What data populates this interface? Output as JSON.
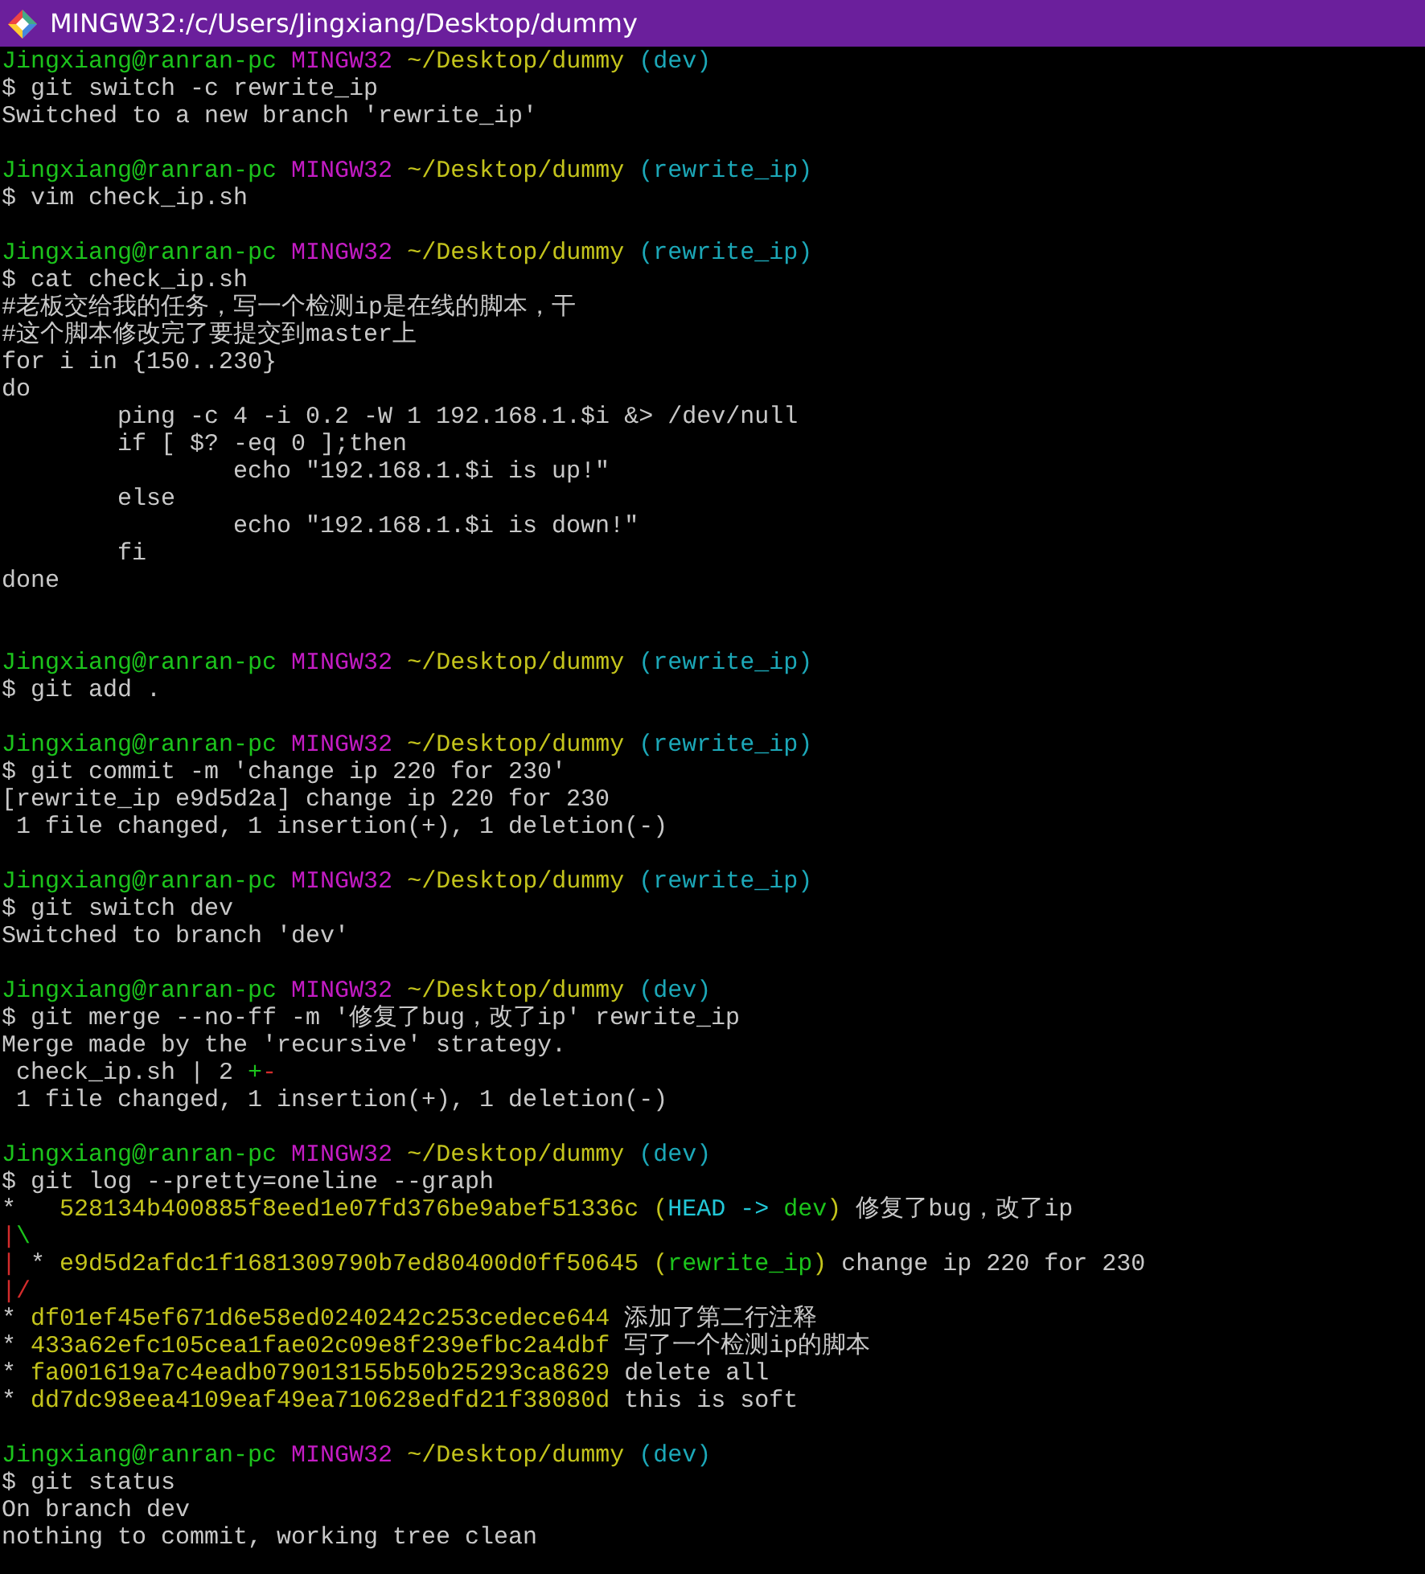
{
  "window": {
    "title": "MINGW32:/c/Users/Jingxiang/Desktop/dummy"
  },
  "lines": [
    {
      "kind": "prompt",
      "user": "Jingxiang@ranran-pc",
      "system": "MINGW32",
      "path": "~/Desktop/dummy",
      "branch": "(dev)"
    },
    {
      "kind": "text",
      "segments": [
        {
          "text": "$ git switch -c rewrite_ip"
        }
      ]
    },
    {
      "kind": "text",
      "segments": [
        {
          "text": "Switched to a new branch 'rewrite_ip'"
        }
      ]
    },
    {
      "kind": "blank"
    },
    {
      "kind": "prompt",
      "user": "Jingxiang@ranran-pc",
      "system": "MINGW32",
      "path": "~/Desktop/dummy",
      "branch": "(rewrite_ip)"
    },
    {
      "kind": "text",
      "segments": [
        {
          "text": "$ vim check_ip.sh"
        }
      ]
    },
    {
      "kind": "blank"
    },
    {
      "kind": "prompt",
      "user": "Jingxiang@ranran-pc",
      "system": "MINGW32",
      "path": "~/Desktop/dummy",
      "branch": "(rewrite_ip)"
    },
    {
      "kind": "text",
      "segments": [
        {
          "text": "$ cat check_ip.sh"
        }
      ]
    },
    {
      "kind": "text",
      "segments": [
        {
          "text": "#老板交给我的任务，写一个检测ip是在线的脚本，干"
        }
      ]
    },
    {
      "kind": "text",
      "segments": [
        {
          "text": "#这个脚本修改完了要提交到master上"
        }
      ]
    },
    {
      "kind": "text",
      "segments": [
        {
          "text": "for i in {150..230}"
        }
      ]
    },
    {
      "kind": "text",
      "segments": [
        {
          "text": "do"
        }
      ]
    },
    {
      "kind": "text",
      "segments": [
        {
          "text": "        ping -c 4 -i 0.2 -W 1 192.168.1.$i &> /dev/null"
        }
      ]
    },
    {
      "kind": "text",
      "segments": [
        {
          "text": "        if [ $? -eq 0 ];then"
        }
      ]
    },
    {
      "kind": "text",
      "segments": [
        {
          "text": "                echo \"192.168.1.$i is up!\""
        }
      ]
    },
    {
      "kind": "text",
      "segments": [
        {
          "text": "        else"
        }
      ]
    },
    {
      "kind": "text",
      "segments": [
        {
          "text": "                echo \"192.168.1.$i is down!\""
        }
      ]
    },
    {
      "kind": "text",
      "segments": [
        {
          "text": "        fi"
        }
      ]
    },
    {
      "kind": "text",
      "segments": [
        {
          "text": "done"
        }
      ]
    },
    {
      "kind": "blank"
    },
    {
      "kind": "blank"
    },
    {
      "kind": "prompt",
      "user": "Jingxiang@ranran-pc",
      "system": "MINGW32",
      "path": "~/Desktop/dummy",
      "branch": "(rewrite_ip)"
    },
    {
      "kind": "text",
      "segments": [
        {
          "text": "$ git add ."
        }
      ]
    },
    {
      "kind": "blank"
    },
    {
      "kind": "prompt",
      "user": "Jingxiang@ranran-pc",
      "system": "MINGW32",
      "path": "~/Desktop/dummy",
      "branch": "(rewrite_ip)"
    },
    {
      "kind": "text",
      "segments": [
        {
          "text": "$ git commit -m 'change ip 220 for 230'"
        }
      ]
    },
    {
      "kind": "text",
      "segments": [
        {
          "text": "[rewrite_ip e9d5d2a] change ip 220 for 230"
        }
      ]
    },
    {
      "kind": "text",
      "segments": [
        {
          "text": " 1 file changed, 1 insertion(+), 1 deletion(-)"
        }
      ]
    },
    {
      "kind": "blank"
    },
    {
      "kind": "prompt",
      "user": "Jingxiang@ranran-pc",
      "system": "MINGW32",
      "path": "~/Desktop/dummy",
      "branch": "(rewrite_ip)"
    },
    {
      "kind": "text",
      "segments": [
        {
          "text": "$ git switch dev"
        }
      ]
    },
    {
      "kind": "text",
      "segments": [
        {
          "text": "Switched to branch 'dev'"
        }
      ]
    },
    {
      "kind": "blank"
    },
    {
      "kind": "prompt",
      "user": "Jingxiang@ranran-pc",
      "system": "MINGW32",
      "path": "~/Desktop/dummy",
      "branch": "(dev)"
    },
    {
      "kind": "text",
      "segments": [
        {
          "text": "$ git merge --no-ff -m '修复了bug，改了ip' rewrite_ip"
        }
      ]
    },
    {
      "kind": "text",
      "segments": [
        {
          "text": "Merge made by the 'recursive' strategy."
        }
      ]
    },
    {
      "kind": "text",
      "segments": [
        {
          "text": " check_ip.sh | 2 "
        },
        {
          "text": "+",
          "color": "#1cc41c"
        },
        {
          "text": "-",
          "color": "#d42c2c"
        }
      ]
    },
    {
      "kind": "text",
      "segments": [
        {
          "text": " 1 file changed, 1 insertion(+), 1 deletion(-)"
        }
      ]
    },
    {
      "kind": "blank"
    },
    {
      "kind": "prompt",
      "user": "Jingxiang@ranran-pc",
      "system": "MINGW32",
      "path": "~/Desktop/dummy",
      "branch": "(dev)"
    },
    {
      "kind": "text",
      "segments": [
        {
          "text": "$ git log --pretty=oneline --graph"
        }
      ]
    },
    {
      "kind": "text",
      "segments": [
        {
          "text": "*   "
        },
        {
          "text": "528134b400885f8eed1e07fd376be9abef51336c (",
          "color": "#c4c41c"
        },
        {
          "text": "HEAD -> ",
          "color": "#22c8d8"
        },
        {
          "text": "dev",
          "color": "#1cc41c"
        },
        {
          "text": ")",
          "color": "#c4c41c"
        },
        {
          "text": " 修复了bug，改了ip"
        }
      ]
    },
    {
      "kind": "text",
      "segments": [
        {
          "text": "|",
          "color": "#d42c2c"
        },
        {
          "text": "\\",
          "color": "#1cc41c"
        }
      ]
    },
    {
      "kind": "text",
      "segments": [
        {
          "text": "|",
          "color": "#d42c2c"
        },
        {
          "text": " * "
        },
        {
          "text": "e9d5d2afdc1f1681309790b7ed80400d0ff50645 (",
          "color": "#c4c41c"
        },
        {
          "text": "rewrite_ip",
          "color": "#1cc41c"
        },
        {
          "text": ")",
          "color": "#c4c41c"
        },
        {
          "text": " change ip 220 for 230"
        }
      ]
    },
    {
      "kind": "text",
      "segments": [
        {
          "text": "|/",
          "color": "#d42c2c"
        }
      ]
    },
    {
      "kind": "text",
      "segments": [
        {
          "text": "* "
        },
        {
          "text": "df01ef45ef671d6e58ed0240242c253cedece644",
          "color": "#c4c41c"
        },
        {
          "text": " 添加了第二行注释"
        }
      ]
    },
    {
      "kind": "text",
      "segments": [
        {
          "text": "* "
        },
        {
          "text": "433a62efc105cea1fae02c09e8f239efbc2a4dbf",
          "color": "#c4c41c"
        },
        {
          "text": " 写了一个检测ip的脚本"
        }
      ]
    },
    {
      "kind": "text",
      "segments": [
        {
          "text": "* "
        },
        {
          "text": "fa001619a7c4eadb079013155b50b25293ca8629",
          "color": "#c4c41c"
        },
        {
          "text": " delete all"
        }
      ]
    },
    {
      "kind": "text",
      "segments": [
        {
          "text": "* "
        },
        {
          "text": "dd7dc98eea4109eaf49ea710628edfd21f38080d",
          "color": "#c4c41c"
        },
        {
          "text": " this is soft"
        }
      ]
    },
    {
      "kind": "blank"
    },
    {
      "kind": "prompt",
      "user": "Jingxiang@ranran-pc",
      "system": "MINGW32",
      "path": "~/Desktop/dummy",
      "branch": "(dev)"
    },
    {
      "kind": "text",
      "segments": [
        {
          "text": "$ git status"
        }
      ]
    },
    {
      "kind": "text",
      "segments": [
        {
          "text": "On branch dev"
        }
      ]
    },
    {
      "kind": "text",
      "segments": [
        {
          "text": "nothing to commit, working tree clean"
        }
      ]
    }
  ]
}
